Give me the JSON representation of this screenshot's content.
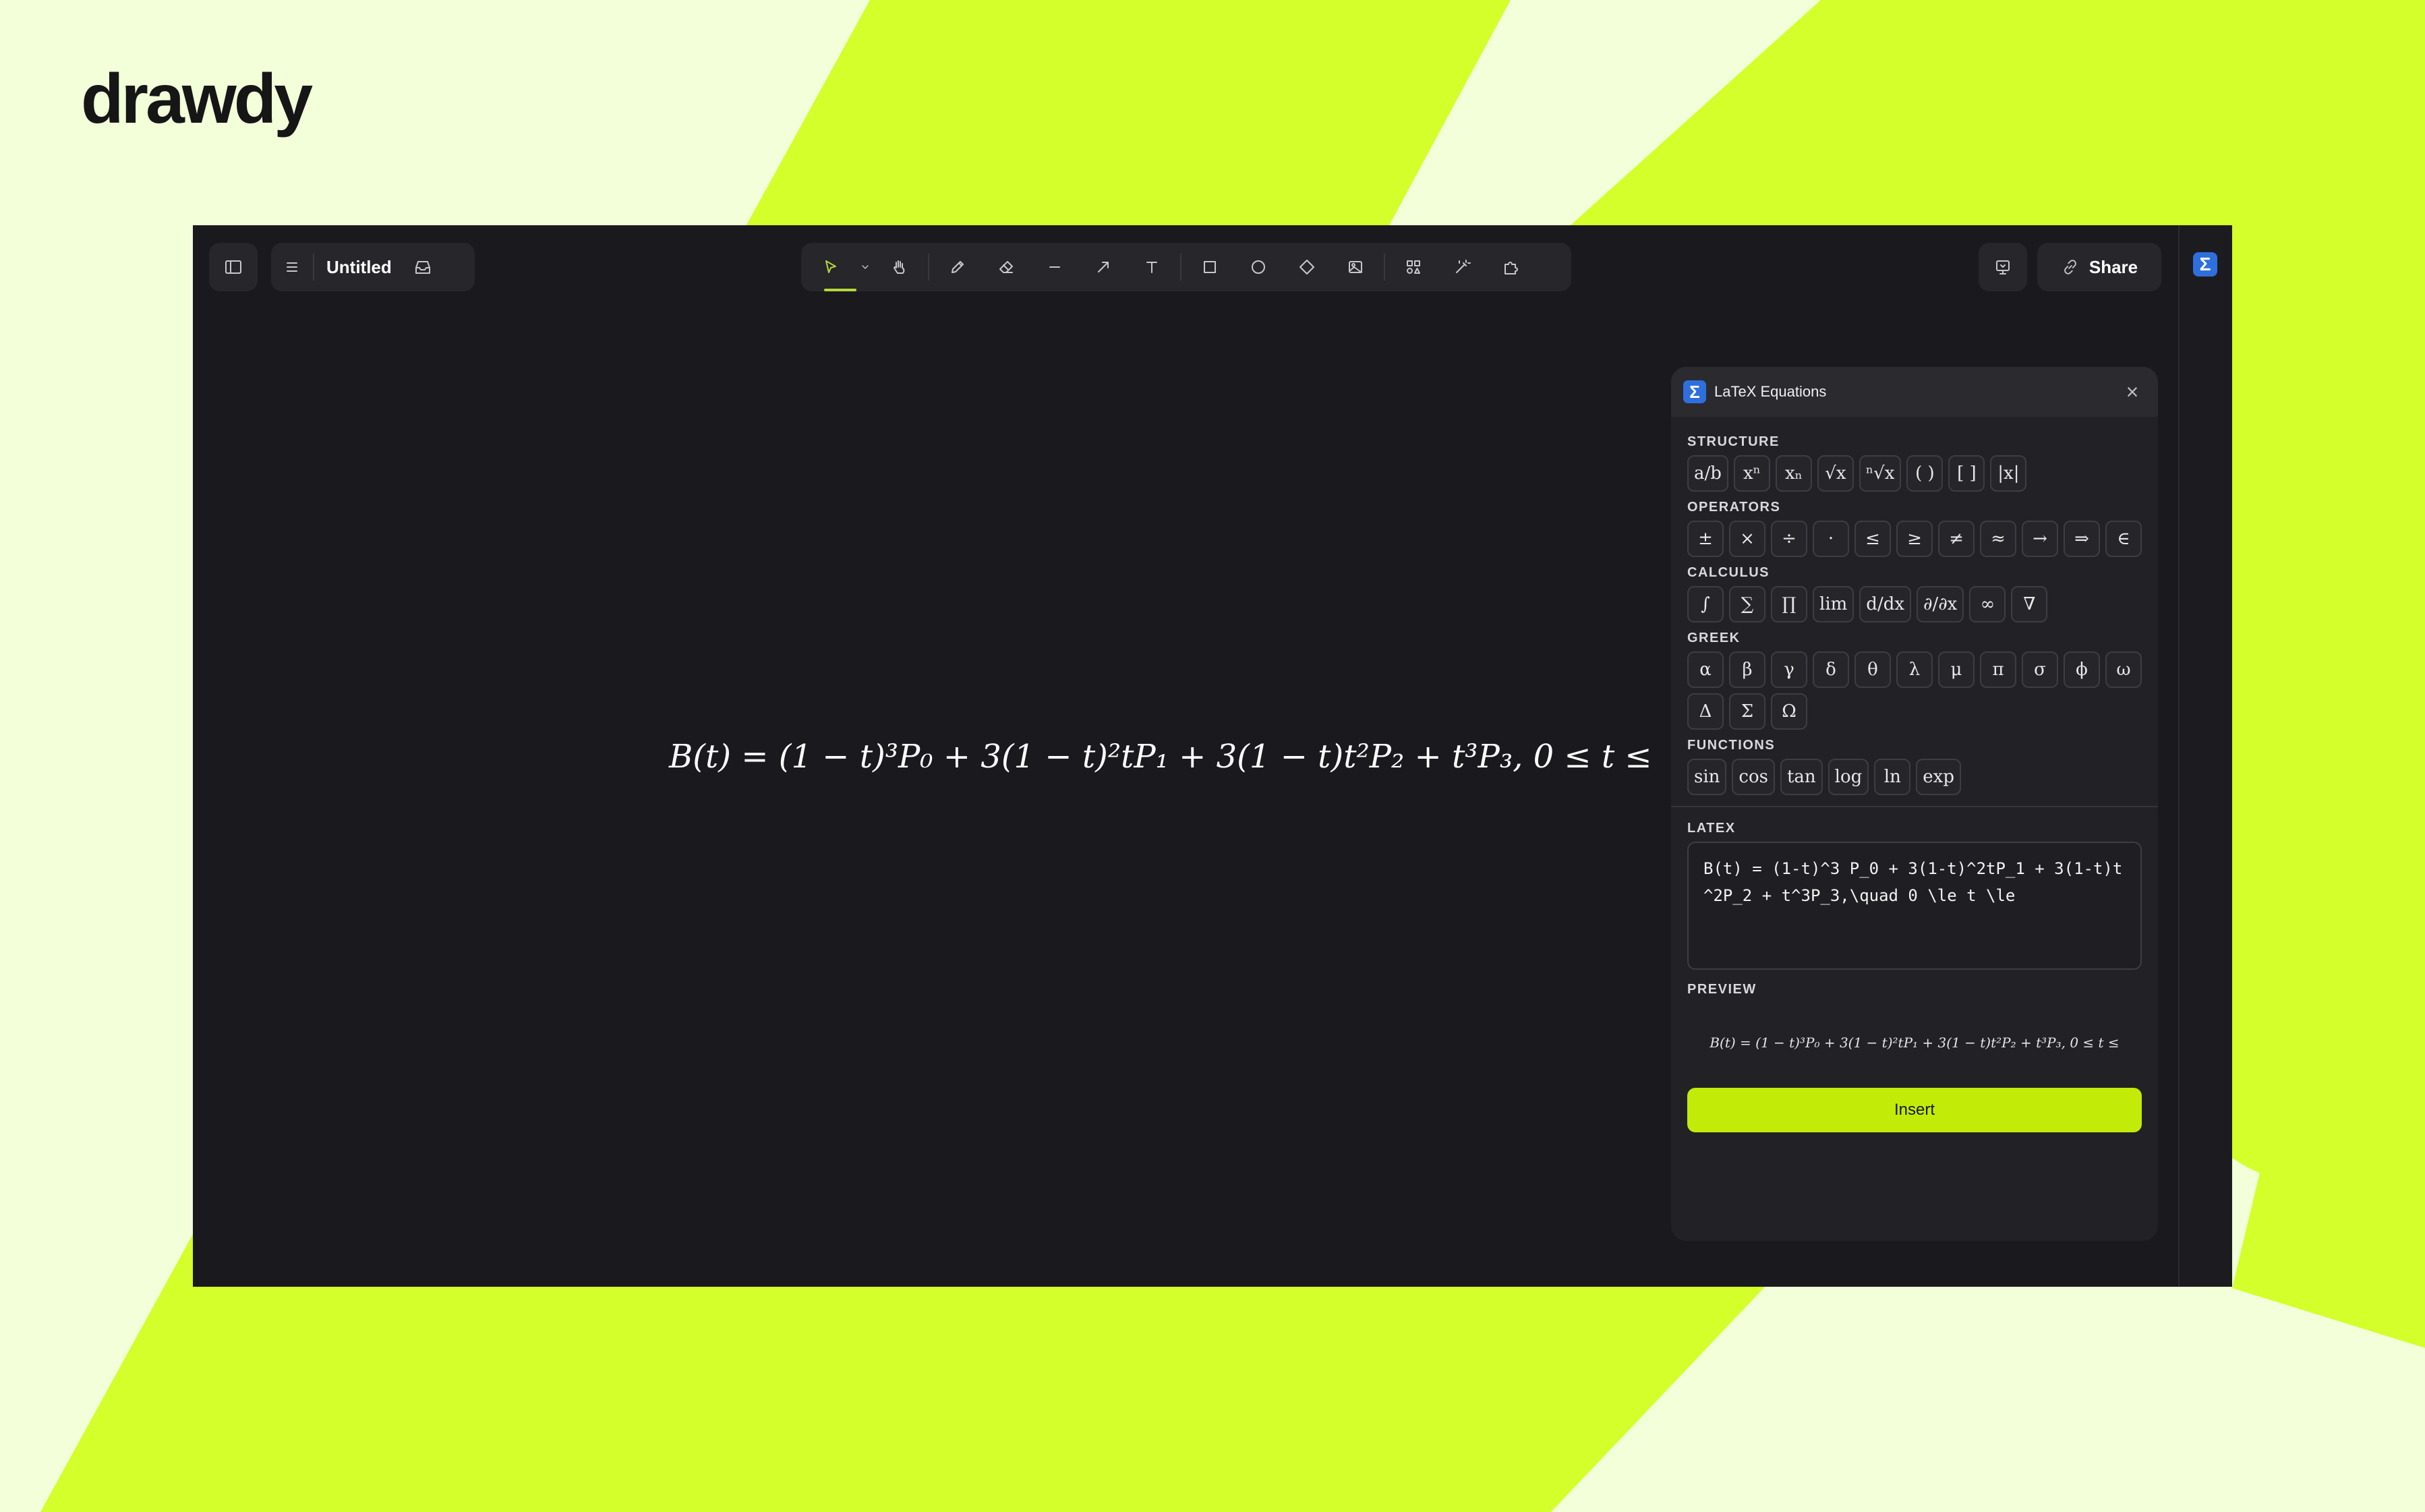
{
  "brand": {
    "logo_text": "drawdy"
  },
  "header": {
    "doc_title": "Untitled",
    "share_label": "Share"
  },
  "toolbar": {
    "tools": [
      {
        "name": "select-tool",
        "icon": "cursor-icon"
      },
      {
        "name": "hand-tool",
        "icon": "hand-icon"
      },
      {
        "name": "pencil-tool",
        "icon": "pencil-icon"
      },
      {
        "name": "eraser-tool",
        "icon": "eraser-icon"
      },
      {
        "name": "line-tool",
        "icon": "line-icon"
      },
      {
        "name": "arrow-tool",
        "icon": "arrow-icon"
      },
      {
        "name": "text-tool",
        "icon": "text-icon"
      },
      {
        "name": "rectangle-tool",
        "icon": "square-icon"
      },
      {
        "name": "ellipse-tool",
        "icon": "circle-icon"
      },
      {
        "name": "diamond-tool",
        "icon": "diamond-icon"
      },
      {
        "name": "image-tool",
        "icon": "image-icon"
      },
      {
        "name": "shapes-library-tool",
        "icon": "shapes-icon"
      },
      {
        "name": "magic-tool",
        "icon": "magic-wand-icon"
      },
      {
        "name": "plugins-tool",
        "icon": "puzzle-icon"
      }
    ],
    "accent": "#b6d83a"
  },
  "canvas": {
    "equation": "B(t) = (1 − t)³P₀ + 3(1 − t)²tP₁ + 3(1 − t)t²P₂ + t³P₃,    0 ≤ t ≤"
  },
  "panel": {
    "title": "LaTeX Equations",
    "structure_label": "STRUCTURE",
    "structure": [
      "a/b",
      "xⁿ",
      "xₙ",
      "√x",
      "ⁿ√x",
      "( )",
      "[ ]",
      "|x|"
    ],
    "operators_label": "OPERATORS",
    "operators": [
      "±",
      "×",
      "÷",
      "·",
      "≤",
      "≥",
      "≠",
      "≈",
      "→",
      "⇒",
      "∈"
    ],
    "calculus_label": "CALCULUS",
    "calculus": [
      "∫",
      "∑",
      "∏",
      "lim",
      "d/dx",
      "∂/∂x",
      "∞",
      "∇"
    ],
    "greek_label": "GREEK",
    "greek": [
      "α",
      "β",
      "γ",
      "δ",
      "θ",
      "λ",
      "μ",
      "π",
      "σ",
      "ϕ",
      "ω",
      "Δ",
      "Σ",
      "Ω"
    ],
    "functions_label": "FUNCTIONS",
    "functions": [
      "sin",
      "cos",
      "tan",
      "log",
      "ln",
      "exp"
    ],
    "latex_label": "LATEX",
    "latex_value": "B(t) = (1-t)^3 P_0 + 3(1-t)^2tP_1 + 3(1-t)t^2P_2 + t^3P_3,\\quad 0 \\le t \\le",
    "preview_label": "PREVIEW",
    "preview_text": "B(t) = (1 − t)³P₀ + 3(1 − t)²tP₁ + 3(1 − t)t²P₂ + t³P₃,   0 ≤ t ≤",
    "insert_label": "Insert",
    "accent": "#c2ec07"
  }
}
